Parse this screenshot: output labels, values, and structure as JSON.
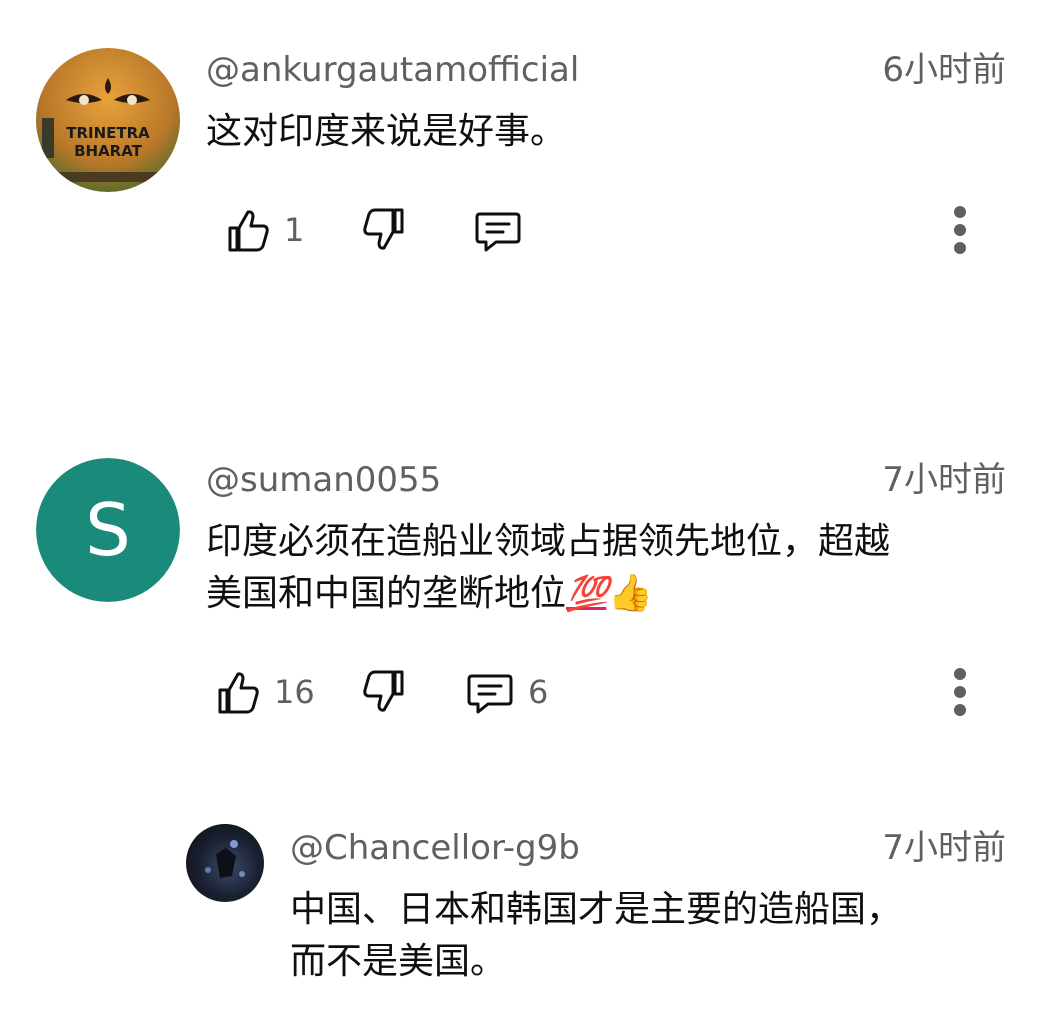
{
  "comments": [
    {
      "author": "@ankurgautamofficial",
      "time": "6小时前",
      "text": "这对印度来说是好事。",
      "avatar": {
        "line1": "TRINETRA",
        "line2": "BHARAT"
      },
      "likes": "1",
      "replies": ""
    },
    {
      "author": "@suman0055",
      "time": "7小时前",
      "text_line1": "印度必须在造船业领域占据领先地位，超越",
      "text_line2": "美国和中国的垄断地位",
      "emoji_100": "💯",
      "emoji_thumb": "👍",
      "avatar": {
        "letter": "S",
        "color": "#1a8a7a"
      },
      "likes": "16",
      "replies": "6"
    },
    {
      "author": "@Chancellor-g9b",
      "time": "7小时前",
      "text_line1": "中国、日本和韩国才是主要的造船国，",
      "text_line2": "而不是美国。"
    }
  ]
}
